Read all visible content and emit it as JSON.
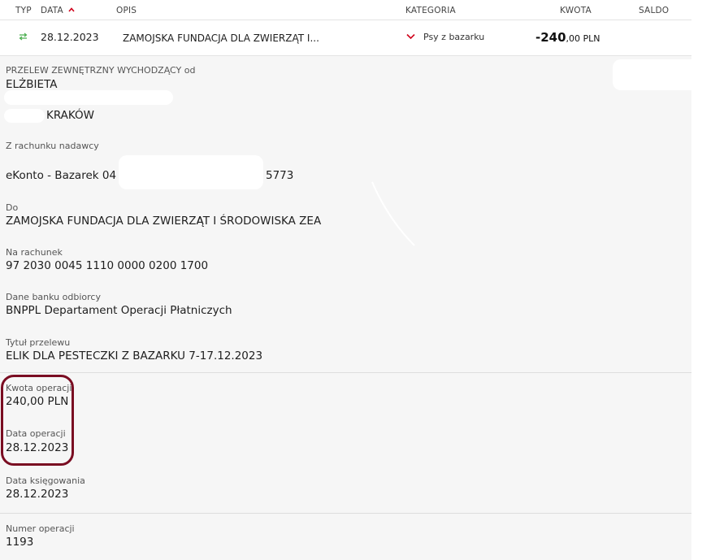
{
  "header": {
    "col_typ": "TYP",
    "col_data": "DATA",
    "col_opis": "OPIS",
    "col_kategoria": "KATEGORIA",
    "col_kwota": "KWOTA",
    "col_saldo": "SALDO"
  },
  "row": {
    "type_icon": "transfer-arrows-icon",
    "date": "28.12.2023",
    "description": "ZAMOJSKA FUNDACJA DLA ZWIERZĄT I...",
    "category": "Psy z bazarku",
    "amount_main": "-240",
    "amount_decimals": ",00 PLN"
  },
  "details": {
    "sender_label": "PRZELEW ZEWNĘTRZNY WYCHODZĄCY od",
    "sender_name": "ELŻBIETA",
    "sender_city": "KRAKÓW",
    "from_account_label": "Z rachunku nadawcy",
    "from_account_prefix": "eKonto - Bazarek 04 1",
    "from_account_suffix": "5773",
    "to_label": "Do",
    "to_value": "ZAMOJSKA FUNDACJA DLA ZWIERZĄT I ŚRODOWISKA ZEA",
    "to_account_label": "Na rachunek",
    "to_account_value": "97 2030 0045 1110 0000 0200 1700",
    "bank_label": "Dane banku odbiorcy",
    "bank_value": "BNPPL Departament Operacji Płatniczych",
    "title_label": "Tytuł przelewu",
    "title_value": "ELIK DLA PESTECZKI Z BAZARKU 7-17.12.2023",
    "amount_label": "Kwota operacji",
    "amount_value": "240,00 PLN",
    "op_date_label": "Data operacji",
    "op_date_value": "28.12.2023",
    "book_date_label": "Data księgowania",
    "book_date_value": "28.12.2023",
    "op_number_label": "Numer operacji",
    "op_number_value": "1193"
  },
  "colors": {
    "accent": "#d0021b",
    "transfer_icon": "#4caf50",
    "annotation": "#7a0d22"
  }
}
